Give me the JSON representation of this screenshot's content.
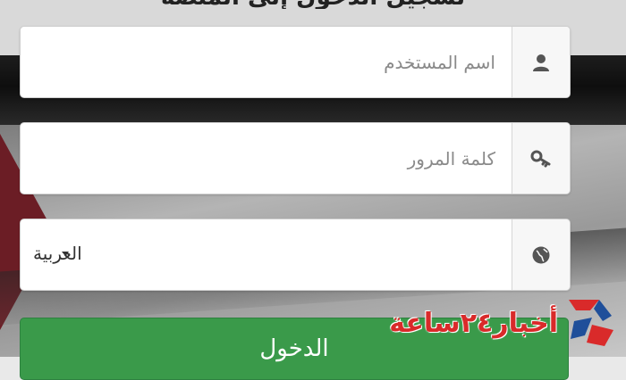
{
  "header": {
    "title": "تسجيل الدخول إلى المنصة"
  },
  "form": {
    "username": {
      "placeholder": "اسم المستخدم",
      "icon": "user-icon"
    },
    "password": {
      "placeholder": "كلمة المرور",
      "icon": "key-icon"
    },
    "language": {
      "value": "العربية",
      "icon": "globe-icon"
    },
    "login_label": "الدخول"
  },
  "watermark": {
    "text": "أخبار٢٤ساعة"
  },
  "colors": {
    "button": "#3a9a4a",
    "accent": "#d92a2a"
  }
}
